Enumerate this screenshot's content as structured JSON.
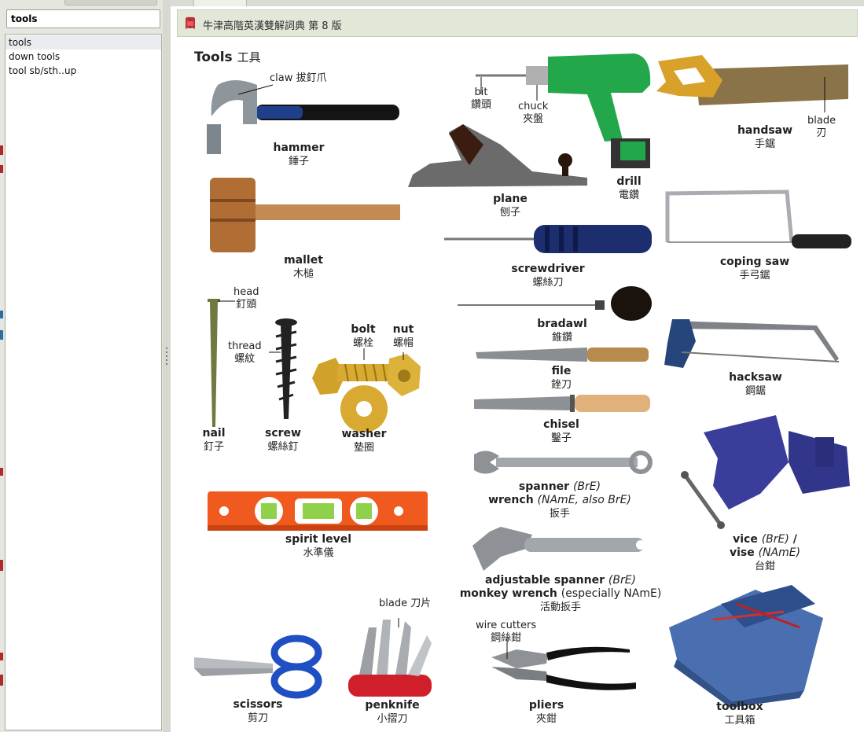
{
  "search": {
    "value": "tools"
  },
  "word_list": [
    "tools",
    "down tools",
    "tool sb/sth‥up"
  ],
  "header": {
    "title": "牛津高階英漢雙解詞典 第 8 版"
  },
  "plate": {
    "title_en": "Tools",
    "title_zh": "工具",
    "items": {
      "hammer": {
        "en": "hammer",
        "zh": "錘子"
      },
      "claw": {
        "en": "claw",
        "zh": "拔釘爪"
      },
      "mallet": {
        "en": "mallet",
        "zh": "木槌"
      },
      "head": {
        "en": "head",
        "zh": "釘頭"
      },
      "thread": {
        "en": "thread",
        "zh": "螺紋"
      },
      "nail": {
        "en": "nail",
        "zh": "釘子"
      },
      "screw": {
        "en": "screw",
        "zh": "螺絲釘"
      },
      "bolt": {
        "en": "bolt",
        "zh": "螺栓"
      },
      "nut": {
        "en": "nut",
        "zh": "螺帽"
      },
      "washer": {
        "en": "washer",
        "zh": "墊圈"
      },
      "spirit_level": {
        "en": "spirit level",
        "zh": "水準儀"
      },
      "scissors": {
        "en": "scissors",
        "zh": "剪刀"
      },
      "penknife": {
        "en": "penknife",
        "zh": "小摺刀"
      },
      "penknife_blade": {
        "en": "blade",
        "zh": "刀片"
      },
      "bit": {
        "en": "bit",
        "zh": "鑽頭"
      },
      "chuck": {
        "en": "chuck",
        "zh": "夾盤"
      },
      "drill": {
        "en": "drill",
        "zh": "電鑽"
      },
      "plane": {
        "en": "plane",
        "zh": "刨子"
      },
      "screwdriver": {
        "en": "screwdriver",
        "zh": "螺絲刀"
      },
      "bradawl": {
        "en": "bradawl",
        "zh": "錐鑽"
      },
      "file": {
        "en": "file",
        "zh": "銼刀"
      },
      "chisel": {
        "en": "chisel",
        "zh": "鑿子"
      },
      "spanner": {
        "en": "spanner",
        "en_tag": "(BrE)",
        "en2": "wrench",
        "en2_tag": "(NAmE, also BrE)",
        "zh": "扳手"
      },
      "adjustable": {
        "en": "adjustable spanner",
        "en_tag": "(BrE)",
        "en2": "monkey wrench",
        "en2_tag": "(especially NAmE)",
        "zh": "活動扳手"
      },
      "wire_cutters": {
        "en": "wire cutters",
        "zh": "鋼絲鉗"
      },
      "pliers": {
        "en": "pliers",
        "zh": "夾鉗"
      },
      "handsaw": {
        "en": "handsaw",
        "zh": "手鋸"
      },
      "saw_blade": {
        "en": "blade",
        "zh": "刃"
      },
      "coping_saw": {
        "en": "coping saw",
        "zh": "手弓鋸"
      },
      "hacksaw": {
        "en": "hacksaw",
        "zh": "鋼鋸"
      },
      "vice": {
        "en": "vice",
        "en_tag": "(BrE)",
        "en2": "vise",
        "en2_tag": "(NAmE)",
        "zh": "台鉗"
      },
      "toolbox": {
        "en": "toolbox",
        "zh": "工具箱"
      }
    }
  },
  "colors": {
    "accent_header": "#e1e7d6",
    "drill_green": "#22a84a",
    "level_orange": "#f05a1e",
    "vise_blue": "#3a3e9a",
    "toolbox_blue": "#4a6fb0",
    "scissors_blue": "#1f4fc2"
  }
}
